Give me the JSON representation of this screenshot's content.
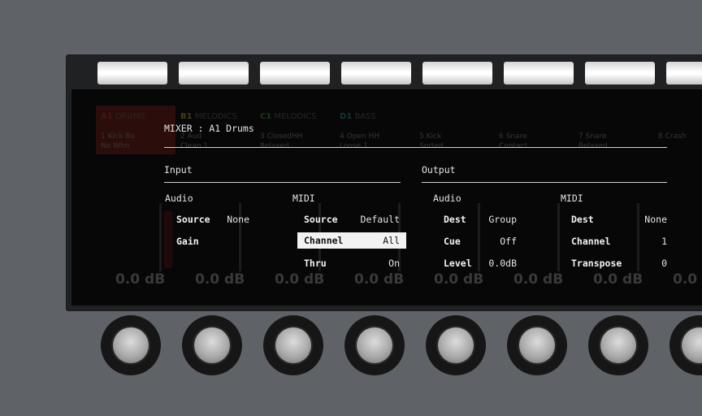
{
  "top_buttons": [
    "btn-1",
    "btn-2",
    "btn-3",
    "btn-4",
    "btn-5",
    "btn-6",
    "btn-7",
    "btn-8"
  ],
  "background_mixer": {
    "groups": [
      {
        "tag": "A1",
        "name": "DRUMS",
        "color": "#e03b2a"
      },
      {
        "tag": "B1",
        "name": "MELODICS",
        "color": "#d9c42a"
      },
      {
        "tag": "C1",
        "name": "MELODICS",
        "color": "#3bbf3b"
      },
      {
        "tag": "D1",
        "name": "BASS",
        "color": "#2ab0a6"
      }
    ],
    "slots": [
      {
        "num": "1",
        "name": "Kick Bo",
        "sub": "No Whn"
      },
      {
        "num": "2",
        "name": "Aud",
        "sub": "Clean 1"
      },
      {
        "num": "3",
        "name": "ClosedHH",
        "sub": "Relaxed"
      },
      {
        "num": "4",
        "name": "Open HH",
        "sub": "Loose 1"
      },
      {
        "num": "5",
        "name": "Kick",
        "sub": "Sorted"
      },
      {
        "num": "6",
        "name": "Snare",
        "sub": "Contact"
      },
      {
        "num": "7",
        "name": "Snare",
        "sub": "Relaxed"
      },
      {
        "num": "8",
        "name": "Crash",
        "sub": ""
      }
    ],
    "levels": [
      "0.0 dB",
      "0.0 dB",
      "0.0 dB",
      "0.0 dB",
      "0.0 dB",
      "0.0 dB",
      "0.0 dB",
      "0.0 d"
    ]
  },
  "overlay": {
    "title": "MIXER : A1 Drums",
    "input": {
      "header": "Input",
      "audio": {
        "label": "Audio",
        "source_key": "Source",
        "source_val": "None",
        "gain_key": "Gain"
      },
      "midi": {
        "label": "MIDI",
        "source_key": "Source",
        "source_val": "Default",
        "channel_key": "Channel",
        "channel_val": "All",
        "thru_key": "Thru",
        "thru_val": "On"
      }
    },
    "output": {
      "header": "Output",
      "audio": {
        "label": "Audio",
        "dest_key": "Dest",
        "dest_val": "Group",
        "cue_key": "Cue",
        "cue_val": "Off",
        "level_key": "Level",
        "level_val": "0.0dB"
      },
      "midi": {
        "label": "MIDI",
        "dest_key": "Dest",
        "dest_val": "None",
        "channel_key": "Channel",
        "channel_val": "1",
        "transpose_key": "Transpose",
        "transpose_val": "0"
      }
    }
  },
  "knobs": [
    "knob-1",
    "knob-2",
    "knob-3",
    "knob-4",
    "knob-5",
    "knob-6",
    "knob-7",
    "knob-8"
  ]
}
